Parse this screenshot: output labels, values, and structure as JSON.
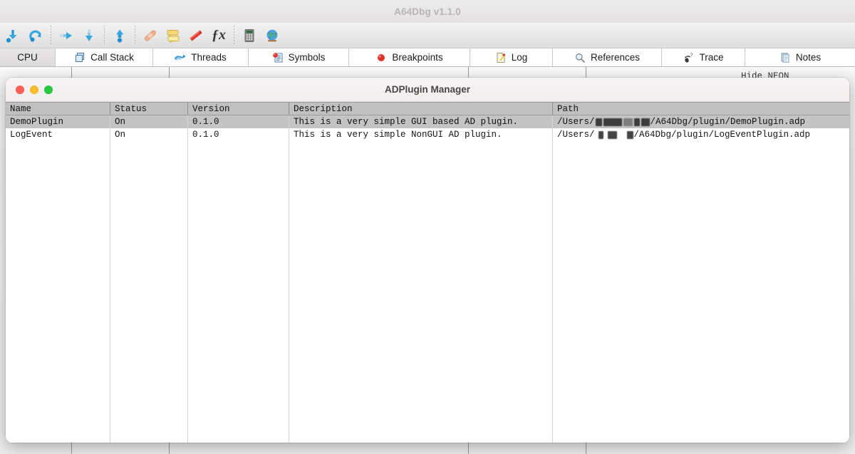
{
  "window": {
    "title": "A64Dbg v1.1.0"
  },
  "toolbar": {
    "buttons": [
      {
        "name": "run-icon",
        "label": "Run"
      },
      {
        "name": "restart-icon",
        "label": "Restart"
      },
      {
        "name": "step-over-icon",
        "label": "Step Over"
      },
      {
        "name": "step-into-icon",
        "label": "Step Into"
      },
      {
        "name": "step-out-icon",
        "label": "Step Out"
      },
      {
        "name": "patch-icon",
        "label": "Patch"
      },
      {
        "name": "comment-icon",
        "label": "Comment"
      },
      {
        "name": "bookmark-icon",
        "label": "Bookmark"
      },
      {
        "name": "function-icon",
        "label": "fx"
      },
      {
        "name": "calculator-icon",
        "label": "Calculator"
      },
      {
        "name": "browser-icon",
        "label": "Browser"
      }
    ]
  },
  "tabs": [
    {
      "label": "CPU",
      "icon": "cpu-icon",
      "active": true
    },
    {
      "label": "Call Stack",
      "icon": "call-stack-icon",
      "active": false
    },
    {
      "label": "Threads",
      "icon": "threads-icon",
      "active": false
    },
    {
      "label": "Symbols",
      "icon": "symbols-icon",
      "active": false
    },
    {
      "label": "Breakpoints",
      "icon": "breakpoints-icon",
      "active": false
    },
    {
      "label": "Log",
      "icon": "log-icon",
      "active": false
    },
    {
      "label": "References",
      "icon": "references-icon",
      "active": false
    },
    {
      "label": "Trace",
      "icon": "trace-icon",
      "active": false
    },
    {
      "label": "Notes",
      "icon": "notes-icon",
      "active": false
    }
  ],
  "workspace": {
    "hidden_label": "Hide NEON"
  },
  "dialog": {
    "title": "ADPlugin Manager",
    "traffic_lights": {
      "close": "#ff5f57",
      "minimize": "#ffbd2e",
      "maximize": "#28c840"
    },
    "table": {
      "columns": [
        "Name",
        "Status",
        "Version",
        "Description",
        "Path"
      ],
      "rows": [
        {
          "name": "DemoPlugin",
          "status": "On",
          "version": "0.1.0",
          "description": "This is a very simple GUI based AD plugin.",
          "path_prefix": "/Users/",
          "path_suffix": "/A64Dbg/plugin/DemoPlugin.adp",
          "selected": true
        },
        {
          "name": "LogEvent",
          "status": "On",
          "version": "0.1.0",
          "description": "This is a very simple NonGUI AD plugin.",
          "path_prefix": "/Users/",
          "path_suffix": "/A64Dbg/plugin/LogEventPlugin.adp",
          "selected": false
        }
      ]
    }
  }
}
